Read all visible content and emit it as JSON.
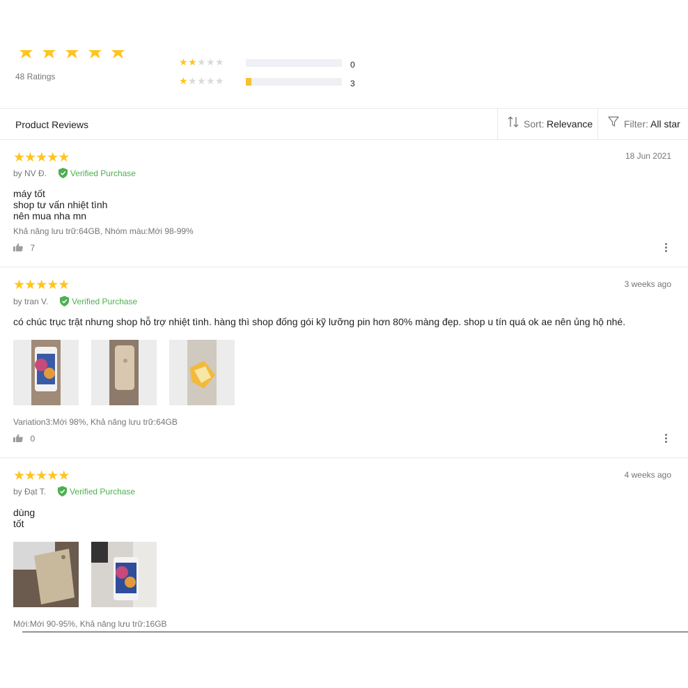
{
  "summary": {
    "ratings_count": "48 Ratings",
    "top_stars": 5,
    "breakdown": [
      {
        "stars": 2,
        "count": "0",
        "fraction": 0.0
      },
      {
        "stars": 1,
        "count": "3",
        "fraction": 0.06
      }
    ]
  },
  "header": {
    "title": "Product Reviews",
    "sort_label": "Sort:",
    "sort_value": "Relevance",
    "filter_label": "Filter:",
    "filter_value": "All star"
  },
  "colors": {
    "star": "#FFC41E",
    "verified": "#4caf50",
    "bar_fill": "#f5c231",
    "bar_track": "#eff0f5"
  },
  "reviews": [
    {
      "rating": 5,
      "author": "by NV Đ.",
      "verified": "Verified Purchase",
      "date": "18 Jun 2021",
      "text": "máy tốt\nshop tư vấn nhiệt tình\nnên mua nha mn",
      "variation": "Khả năng lưu trữ:64GB, Nhóm màu:Mới 98-99%",
      "likes": "7",
      "images": []
    },
    {
      "rating": 5,
      "author": "by tran V.",
      "verified": "Verified Purchase",
      "date": "3 weeks ago",
      "text": "có chúc trục trật nhưng shop hỗ trợ nhiệt tình.  hàng thì shop đống gói kỹ lưỡng pin hơn 80% màng đẹp.  shop u tín quá ok ae nên ủng hộ nhé.",
      "variation": "Variation3:Mới 98%, Khả năng lưu trữ:64GB",
      "likes": "0",
      "images": [
        "phone-front-photo",
        "phone-back-photo",
        "packaged-phone-photo"
      ]
    },
    {
      "rating": 5,
      "author": "by Đạt T.",
      "verified": "Verified Purchase",
      "date": "4 weeks ago",
      "text": "dùng\ntốt",
      "variation": "Mới:Mới 90-95%, Khả năng lưu trữ:16GB",
      "images": [
        "phone-back-photo",
        "phone-front-photo"
      ]
    }
  ]
}
